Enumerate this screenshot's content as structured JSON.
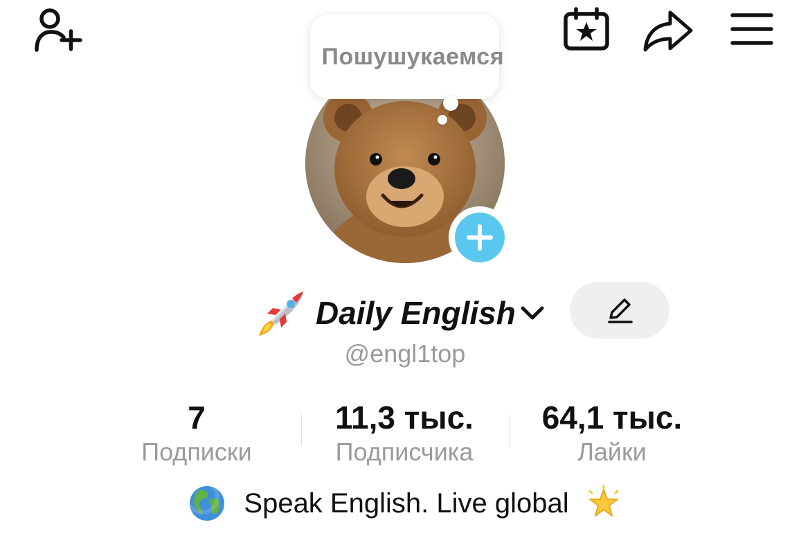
{
  "top_bar": {
    "icons": [
      "add-friend-icon",
      "calendar-star-icon",
      "share-arrow-icon",
      "hamburger-menu-icon"
    ]
  },
  "bubble": {
    "text": "Пошушукаемся"
  },
  "profile": {
    "display_name": "Daily English",
    "name_emoji": "rocket-icon",
    "username": "@engl1top",
    "accent": "#5ac8ee"
  },
  "stats": [
    {
      "value": "7",
      "label": "Подписки"
    },
    {
      "value": "11,3 тыс.",
      "label": "Подписчика"
    },
    {
      "value": "64,1 тыс.",
      "label": "Лайки"
    }
  ],
  "bio": {
    "text": "Speak English. Live global"
  }
}
